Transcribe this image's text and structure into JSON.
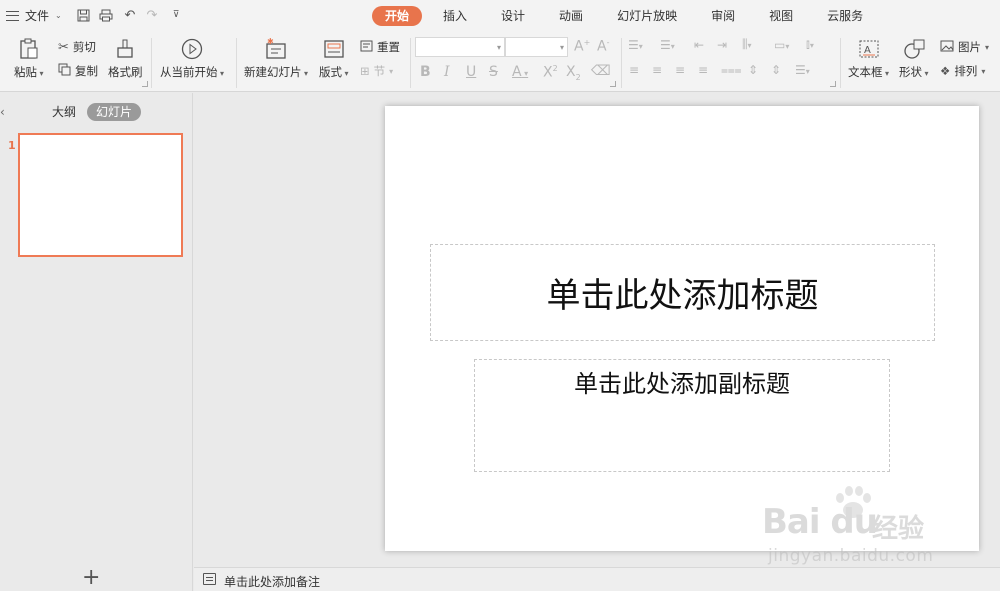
{
  "menu": {
    "file_label": "文件"
  },
  "tabs": [
    {
      "label": "开始",
      "active": true
    },
    {
      "label": "插入",
      "active": false
    },
    {
      "label": "设计",
      "active": false
    },
    {
      "label": "动画",
      "active": false
    },
    {
      "label": "幻灯片放映",
      "active": false
    },
    {
      "label": "审阅",
      "active": false
    },
    {
      "label": "视图",
      "active": false
    },
    {
      "label": "云服务",
      "active": false
    }
  ],
  "ribbon": {
    "paste": "粘贴",
    "cut": "剪切",
    "copy": "复制",
    "format_painter": "格式刷",
    "from_current": "从当前开始",
    "new_slide": "新建幻灯片",
    "layout": "版式",
    "reset": "重置",
    "section": "节",
    "text_box": "文本框",
    "shape": "形状",
    "picture": "图片",
    "arrange": "排列"
  },
  "left_pane": {
    "outline_tab": "大纲",
    "slides_tab": "幻灯片",
    "slide_number": "1"
  },
  "slide": {
    "title_placeholder": "单击此处添加标题",
    "subtitle_placeholder": "单击此处添加副标题"
  },
  "notes": {
    "placeholder": "单击此处添加备注"
  },
  "watermark": {
    "logo": "Bai du",
    "brand_cn": "经验",
    "url": "jingyan.baidu.com"
  },
  "colors": {
    "accent": "#e8744c",
    "slide_border": "#ef7a55"
  }
}
